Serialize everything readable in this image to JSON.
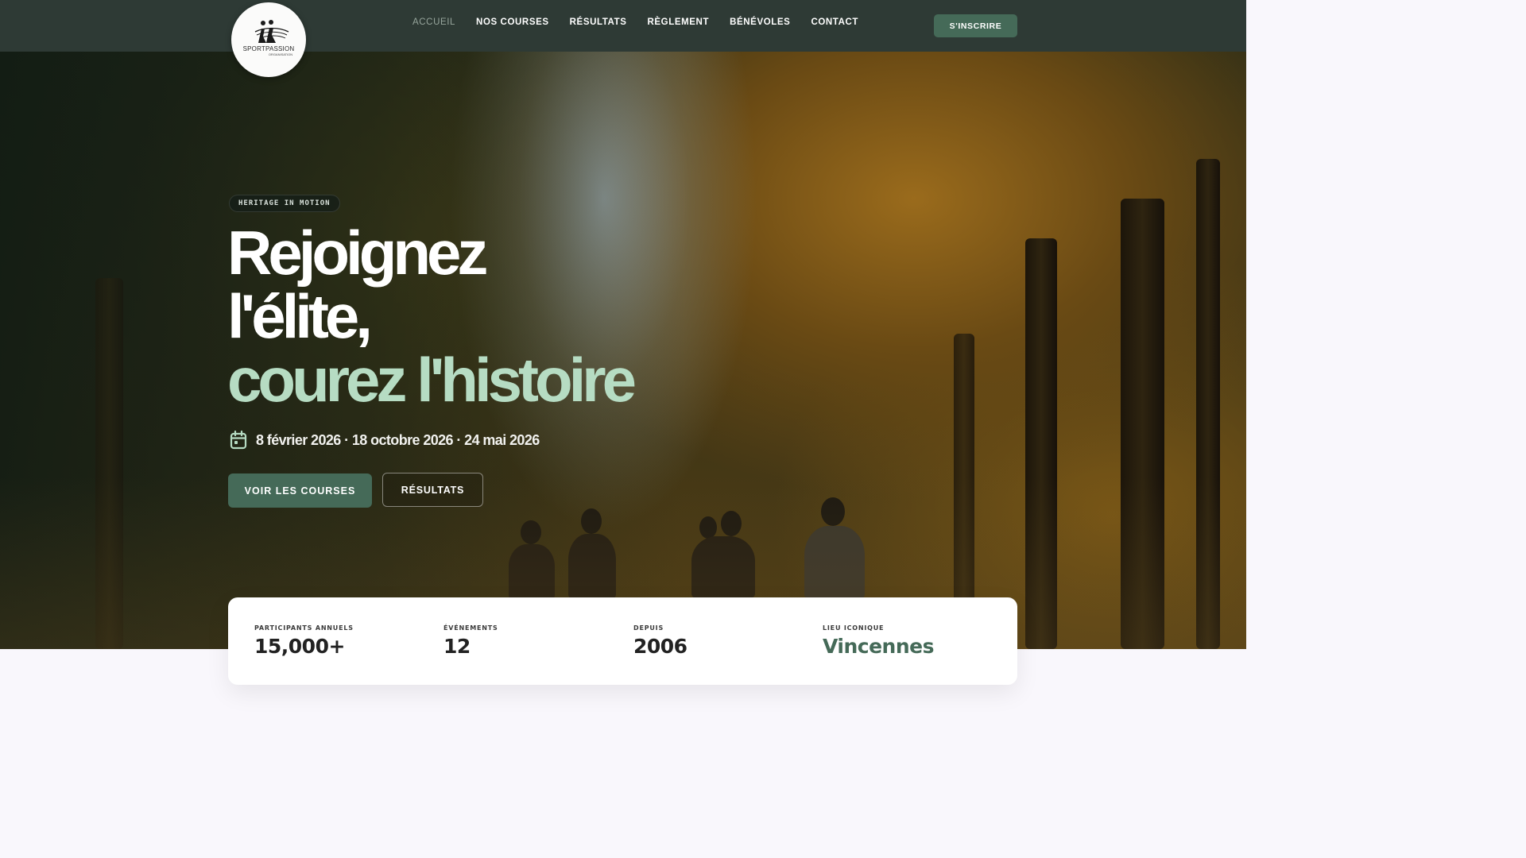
{
  "nav": {
    "logo_text": "SPORTPASSION",
    "logo_sub": "ORGANISATION",
    "links": [
      {
        "label": "ACCUEIL",
        "active": true
      },
      {
        "label": "NOS COURSES"
      },
      {
        "label": "RÉSULTATS"
      },
      {
        "label": "RÈGLEMENT"
      },
      {
        "label": "BÉNÉVOLES"
      },
      {
        "label": "CONTACT"
      }
    ],
    "signup_label": "S'INSCRIRE"
  },
  "hero": {
    "badge": "HERITAGE IN MOTION",
    "title_line1": "Rejoignez",
    "title_line2": "l'élite,",
    "title_line3": "courez l'histoire",
    "dates": "8 février 2026 · 18 octobre 2026 · 24 mai 2026",
    "primary_button": "VOIR LES COURSES",
    "secondary_button": "RÉSULTATS"
  },
  "stats": [
    {
      "label": "PARTICIPANTS ANNUELS",
      "value": "15,000+"
    },
    {
      "label": "ÉVÉNEMENTS",
      "value": "12"
    },
    {
      "label": "DEPUIS",
      "value": "2006"
    },
    {
      "label": "LIEU ICONIQUE",
      "value": "Vincennes"
    }
  ],
  "colors": {
    "navbar": "#2e3a35",
    "primary": "#456a58",
    "accent_text": "#b6dcc3"
  },
  "icons": {
    "calendar": "calendar-icon",
    "logo": "runners-logo"
  }
}
